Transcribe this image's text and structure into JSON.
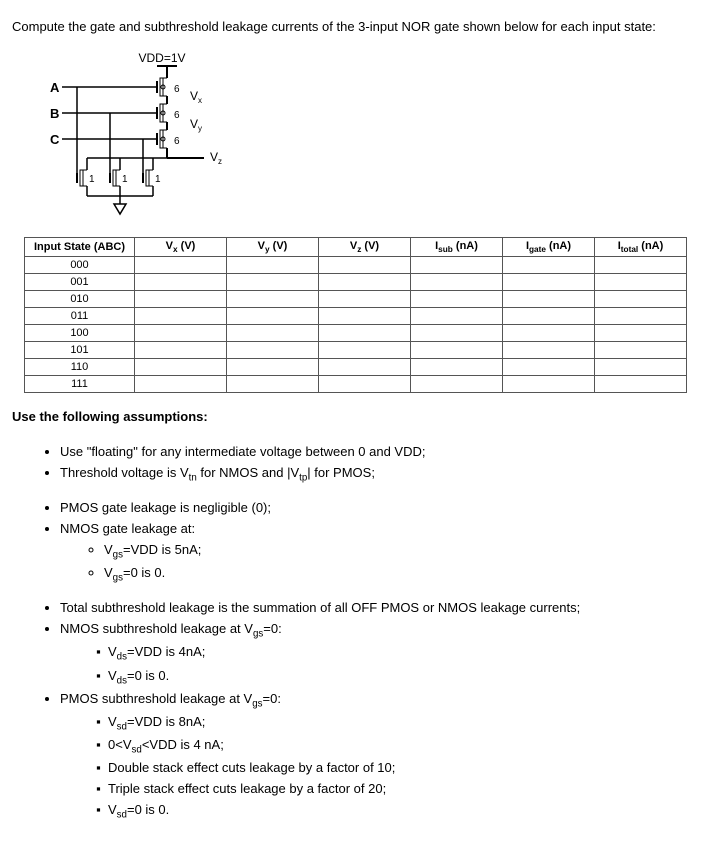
{
  "prompt": "Compute the gate and subthreshold leakage currents of the 3-input NOR gate shown below for each input state:",
  "circuit": {
    "vdd_label": "VDD=1V",
    "labels": {
      "A": "A",
      "B": "B",
      "C": "C",
      "Vx": "V",
      "Vx_sub": "x",
      "Vy": "V",
      "Vy_sub": "y",
      "Vz": "V",
      "Vz_sub": "z"
    },
    "pmos_w": "6",
    "nmos_w": "1"
  },
  "table": {
    "headers": [
      "Input State (ABC)",
      "Vₓ (V)",
      "Vᵧ (V)",
      "V_z (V)",
      "I_sub (nA)",
      "I_gate (nA)",
      "I_total (nA)"
    ],
    "header_html": {
      "h0": "Input State (ABC)",
      "h1_pre": "V",
      "h1_sub": "x",
      "h1_post": " (V)",
      "h2_pre": "V",
      "h2_sub": "y",
      "h2_post": " (V)",
      "h3_pre": "V",
      "h3_sub": "z",
      "h3_post": " (V)",
      "h4_pre": "I",
      "h4_sub": "sub",
      "h4_post": " (nA)",
      "h5_pre": "I",
      "h5_sub": "gate",
      "h5_post": " (nA)",
      "h6_pre": "I",
      "h6_sub": "total",
      "h6_post": " (nA)"
    },
    "rows": [
      "000",
      "001",
      "010",
      "011",
      "100",
      "101",
      "110",
      "111"
    ]
  },
  "assumptions_hdr": "Use the following assumptions:",
  "assumptions": {
    "a1": "Use \"floating\" for any intermediate voltage between 0 and VDD;",
    "a2_pre": "Threshold voltage is V",
    "a2_sub1": "tn",
    "a2_mid": " for NMOS and |V",
    "a2_sub2": "tp",
    "a2_post": "| for PMOS;",
    "a3": "PMOS gate leakage is negligible (0);",
    "a4": "NMOS gate leakage at:",
    "a4a_pre": "V",
    "a4a_sub": "gs",
    "a4a_post": "=VDD is 5nA;",
    "a4b_pre": "V",
    "a4b_sub": "gs",
    "a4b_post": "=0 is 0.",
    "a5": "Total subthreshold leakage is the summation of all OFF PMOS or NMOS leakage currents;",
    "a6_pre": "NMOS subthreshold leakage at V",
    "a6_sub": "gs",
    "a6_post": "=0:",
    "a6a_pre": "V",
    "a6a_sub": "ds",
    "a6a_post": "=VDD is 4nA;",
    "a6b_pre": "V",
    "a6b_sub": "ds",
    "a6b_post": "=0 is 0.",
    "a7_pre": "PMOS subthreshold leakage at V",
    "a7_sub": "gs",
    "a7_post": "=0:",
    "a7a_pre": "V",
    "a7a_sub": "sd",
    "a7a_post": "=VDD is 8nA;",
    "a7b_pre": "0<V",
    "a7b_sub": "sd",
    "a7b_post": "<VDD is 4 nA;",
    "a7c": "Double stack effect cuts leakage by a factor of 10;",
    "a7d": "Triple stack effect cuts leakage by a factor of 20;",
    "a7e_pre": "V",
    "a7e_sub": "sd",
    "a7e_post": "=0 is 0."
  }
}
